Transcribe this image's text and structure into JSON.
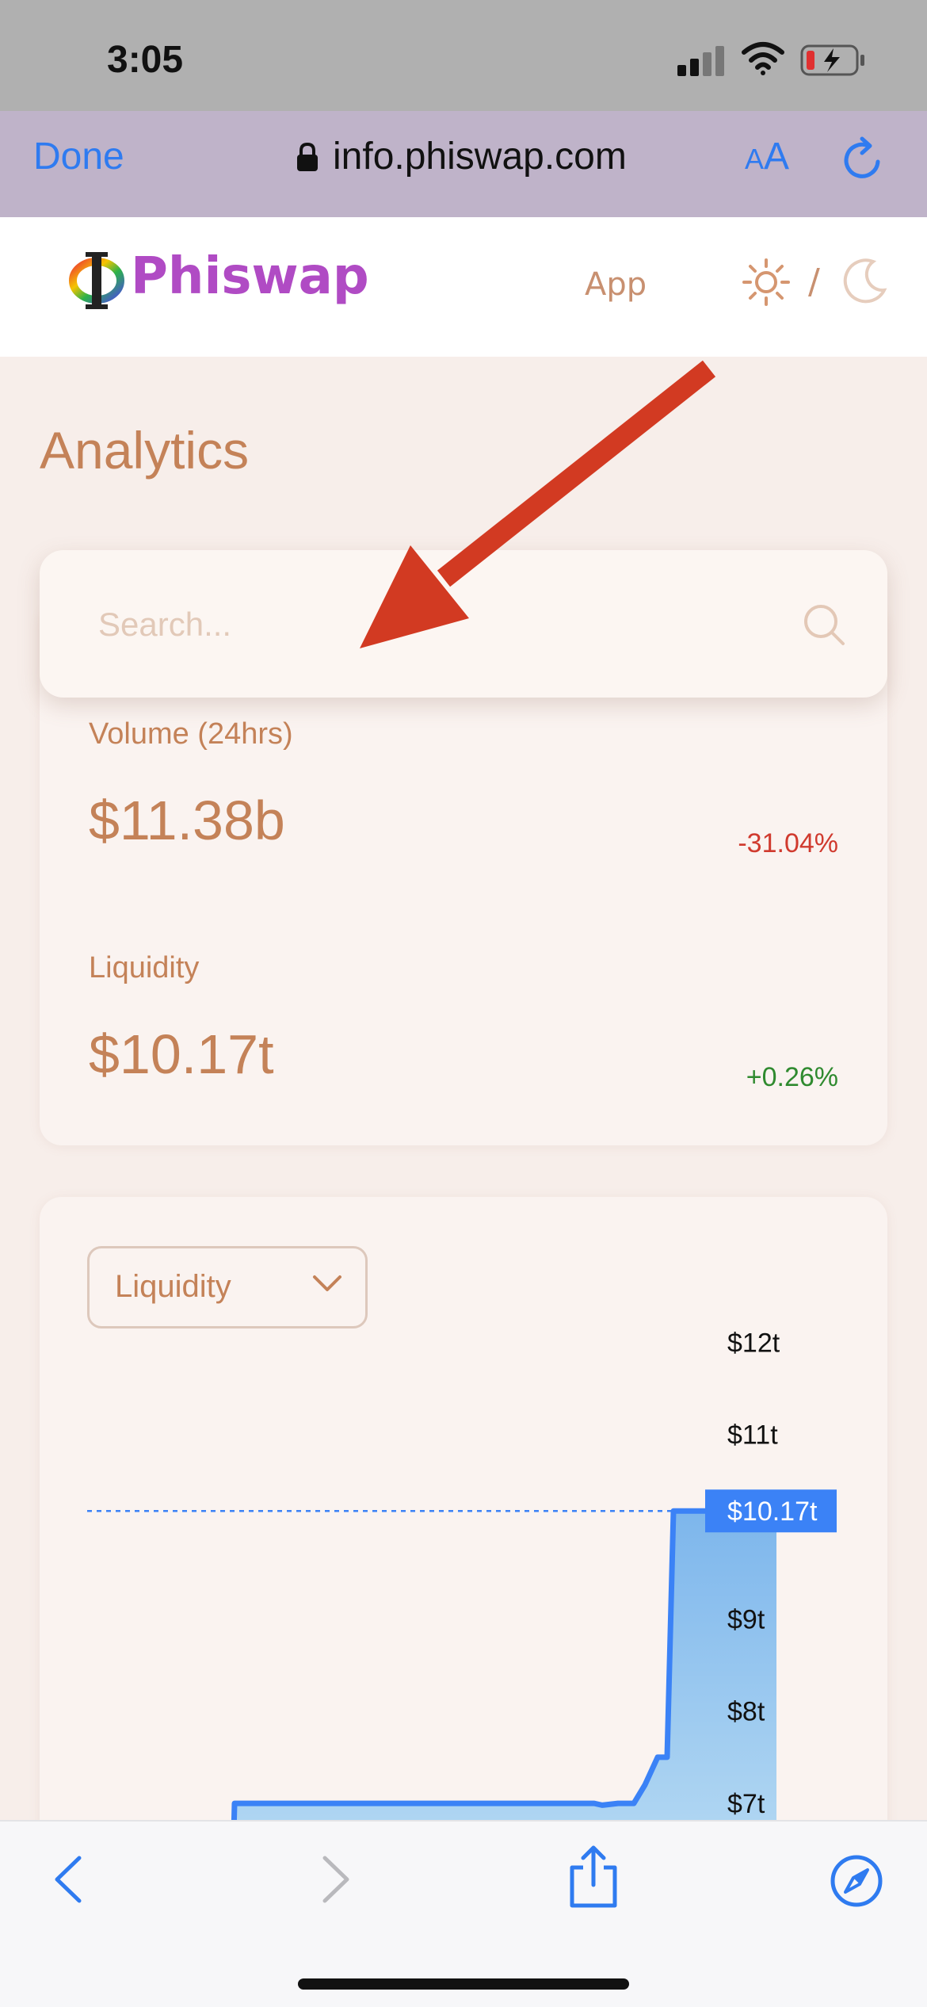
{
  "status_bar": {
    "time": "3:05"
  },
  "safari": {
    "done_label": "Done",
    "url": "info.phiswap.com",
    "text_size_label_small": "A",
    "text_size_label_large": "A"
  },
  "header": {
    "brand": "Phiswap",
    "nav_app": "App",
    "theme_separator": "/"
  },
  "page": {
    "title": "Analytics"
  },
  "search": {
    "placeholder": "Search..."
  },
  "stats": {
    "volume_label": "Volume (24hrs)",
    "volume_value": "$11.38b",
    "volume_change": "-31.04%",
    "liquidity_label": "Liquidity",
    "liquidity_value": "$10.17t",
    "liquidity_change": "+0.26%"
  },
  "chart": {
    "selected_metric": "Liquidity"
  },
  "chart_data": {
    "type": "area",
    "title": "",
    "y_ticks": [
      "$12t",
      "$11t",
      "$10t",
      "$9t",
      "$8t",
      "$7t"
    ],
    "y_tick_values": [
      12,
      11,
      10,
      9,
      8,
      7
    ],
    "current_label": "$10.17t",
    "current_value": 10.17,
    "ylim": [
      6.7,
      12.2
    ],
    "series": [
      {
        "values": [
          5.0,
          5.0,
          7.0,
          7.0,
          7.0,
          7.0,
          7.0,
          7.0,
          7.0,
          7.0,
          7.0,
          6.98,
          7.0,
          7.0,
          7.2,
          7.5,
          7.5,
          10.17,
          10.17,
          10.17,
          10.17,
          10.17
        ]
      }
    ],
    "grid": false,
    "colors": {
      "line": "#3b82f6",
      "fill_top": "#7db6ec",
      "fill_bottom": "#c9e6f5",
      "label_bg": "#3b82f6"
    }
  },
  "icons": {
    "lock": "lock-icon",
    "reload": "reload-icon",
    "sun": "sun-icon",
    "moon": "moon-icon",
    "search": "search-icon",
    "chevron": "chevron-down-icon",
    "back": "back-icon",
    "forward": "forward-icon",
    "share": "share-icon",
    "compass": "compass-icon"
  }
}
